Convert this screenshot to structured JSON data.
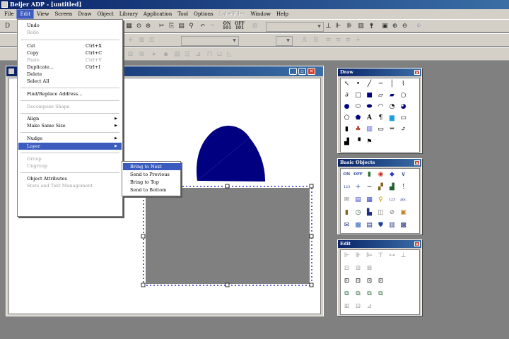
{
  "app": {
    "title": "Beijer ADP - [untitled]"
  },
  "menubar": {
    "items": [
      {
        "label": "File"
      },
      {
        "label": "Edit",
        "active": true
      },
      {
        "label": "View"
      },
      {
        "label": "Screen"
      },
      {
        "label": "Draw"
      },
      {
        "label": "Object"
      },
      {
        "label": "Library"
      },
      {
        "label": "Application"
      },
      {
        "label": "Tool"
      },
      {
        "label": "Options"
      },
      {
        "label": "LabelFiles",
        "disabled": true
      },
      {
        "label": "Window"
      },
      {
        "label": "Help"
      }
    ]
  },
  "edit_menu": {
    "undo": "Undo",
    "redo": "Redo",
    "cut": "Cut",
    "cut_sc": "Ctrl+X",
    "copy": "Copy",
    "copy_sc": "Ctrl+C",
    "paste": "Paste",
    "paste_sc": "Ctrl+V",
    "duplicate": "Duplicate...",
    "duplicate_sc": "Ctrl+I",
    "delete": "Delete",
    "select_all": "Select All",
    "find_replace": "Find/Replace Address...",
    "decompose": "Decompose Shape",
    "align": "Align",
    "make_same_size": "Make Same Size",
    "nudge": "Nudge",
    "layer": "Layer",
    "group": "Group",
    "ungroup": "Ungroup",
    "object_attributes": "Object Attributes",
    "state_text": "State and Text Management"
  },
  "layer_submenu": {
    "bring_next": "Bring to Next",
    "send_previous": "Send to Previous",
    "bring_top": "Bring to Top",
    "send_bottom": "Send to Bottom"
  },
  "toolbar_text": {
    "on": "ON",
    "off": "OFF",
    "on_sub": "101",
    "off_sub": "101"
  },
  "panels": {
    "draw": {
      "title": "Draw"
    },
    "basic": {
      "title": "Basic Objects",
      "on": "ON",
      "off": "OFF"
    },
    "edit": {
      "title": "Edit"
    }
  },
  "colors": {
    "accent": "#3b5bbf",
    "shape_fill": "#000080",
    "rect_fill": "#808080",
    "handles": "#3030c0"
  }
}
